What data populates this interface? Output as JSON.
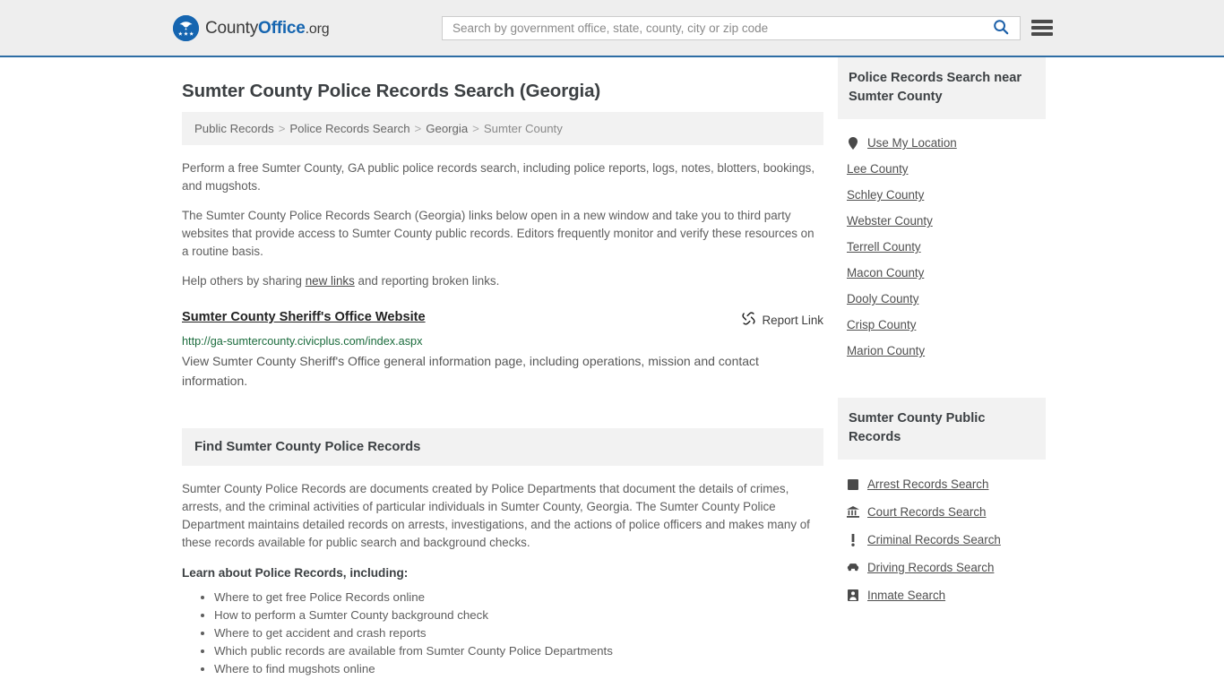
{
  "header": {
    "logo": {
      "icon": "eagle-seal-icon",
      "part1": "County",
      "part2": "Office",
      "part3": ".org"
    },
    "search": {
      "placeholder": "Search by government office, state, county, city or zip code",
      "value": "",
      "search_icon": "search-icon"
    },
    "menu_icon": "hamburger-menu-icon",
    "accent_color": "#1565b0",
    "background_color": "#eeeeee"
  },
  "main": {
    "title": "Sumter County Police Records Search (Georgia)",
    "breadcrumb": [
      {
        "label": "Public Records",
        "current": false
      },
      {
        "label": "Police Records Search",
        "current": false
      },
      {
        "label": "Georgia",
        "current": false
      },
      {
        "label": "Sumter County",
        "current": true
      }
    ],
    "breadcrumb_separator": ">",
    "intro_paragraph_1": "Perform a free Sumter County, GA public police records search, including police reports, logs, notes, blotters, bookings, and mugshots.",
    "intro_paragraph_2": "The Sumter County Police Records Search (Georgia) links below open in a new window and take you to third party websites that provide access to Sumter County public records. Editors frequently monitor and verify these resources on a routine basis.",
    "share_prefix": "Help others by sharing ",
    "share_link": "new links",
    "share_suffix": " and reporting broken links.",
    "result": {
      "title": "Sumter County Sheriff's Office Website",
      "report_label": "Report Link",
      "report_icon": "broken-link-icon",
      "url": "http://ga-sumtercounty.civicplus.com/index.aspx",
      "url_color": "#1a6b3c",
      "description": "View Sumter County Sheriff's Office general information page, including operations, mission and contact information."
    },
    "section": {
      "heading": "Find Sumter County Police Records",
      "paragraph": "Sumter County Police Records are documents created by Police Departments that document the details of crimes, arrests, and the criminal activities of particular individuals in Sumter County, Georgia. The Sumter County Police Department maintains detailed records on arrests, investigations, and the actions of police officers and makes many of these records available for public search and background checks.",
      "learn_heading": "Learn about Police Records, including:",
      "learn_items": [
        "Where to get free Police Records online",
        "How to perform a Sumter County background check",
        "Where to get accident and crash reports",
        "Which public records are available from Sumter County Police Departments",
        "Where to find mugshots online"
      ]
    }
  },
  "sidebar": {
    "nearby": {
      "heading": "Police Records Search near Sumter County",
      "items": [
        {
          "label": "Use My Location",
          "icon": "map-pin-icon"
        },
        {
          "label": "Lee County",
          "icon": ""
        },
        {
          "label": "Schley County",
          "icon": ""
        },
        {
          "label": "Webster County",
          "icon": ""
        },
        {
          "label": "Terrell County",
          "icon": ""
        },
        {
          "label": "Macon County",
          "icon": ""
        },
        {
          "label": "Dooly County",
          "icon": ""
        },
        {
          "label": "Crisp County",
          "icon": ""
        },
        {
          "label": "Marion County",
          "icon": ""
        }
      ]
    },
    "public_records": {
      "heading": "Sumter County Public Records",
      "items": [
        {
          "label": "Arrest Records Search",
          "icon": "fingerprint-icon"
        },
        {
          "label": "Court Records Search",
          "icon": "courthouse-icon"
        },
        {
          "label": "Criminal Records Search",
          "icon": "exclamation-icon"
        },
        {
          "label": "Driving Records Search",
          "icon": "car-icon"
        },
        {
          "label": "Inmate Search",
          "icon": "inmate-icon"
        }
      ]
    }
  }
}
